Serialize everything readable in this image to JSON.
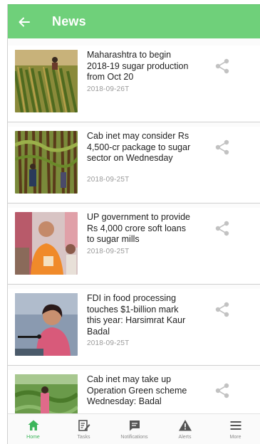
{
  "appbar": {
    "back_icon": "arrow-left-icon",
    "title": "News",
    "color": "#6fd07a"
  },
  "news": [
    {
      "headline": "Maharashtra to begin 2018-19 sugar production from Oct 20",
      "date": "2018-09-26T"
    },
    {
      "headline": "Cab inet may consider Rs 4,500-cr package to sugar sector on Wednesday",
      "date": "2018-09-25T"
    },
    {
      "headline": "UP government to provide Rs 4,000 crore soft loans to sugar mills",
      "date": "2018-09-25T"
    },
    {
      "headline": "FDI in food processing touches $1-billion mark this year: Harsimrat Kaur Badal",
      "date": "2018-09-25T"
    },
    {
      "headline": "Cab inet may take up Operation Green scheme Wednesday: Badal",
      "date": ""
    }
  ],
  "bottom_nav": [
    {
      "label": "Home",
      "icon": "home-icon",
      "active": true
    },
    {
      "label": "Tasks",
      "icon": "edit-note-icon",
      "active": false
    },
    {
      "label": "Notifications",
      "icon": "message-icon",
      "active": false
    },
    {
      "label": "Alerts",
      "icon": "warning-icon",
      "active": false
    },
    {
      "label": "More",
      "icon": "menu-icon",
      "active": false
    }
  ],
  "colors": {
    "accent": "#6fd07a",
    "active_nav": "#3cb55a",
    "inactive_nav": "#555555"
  }
}
